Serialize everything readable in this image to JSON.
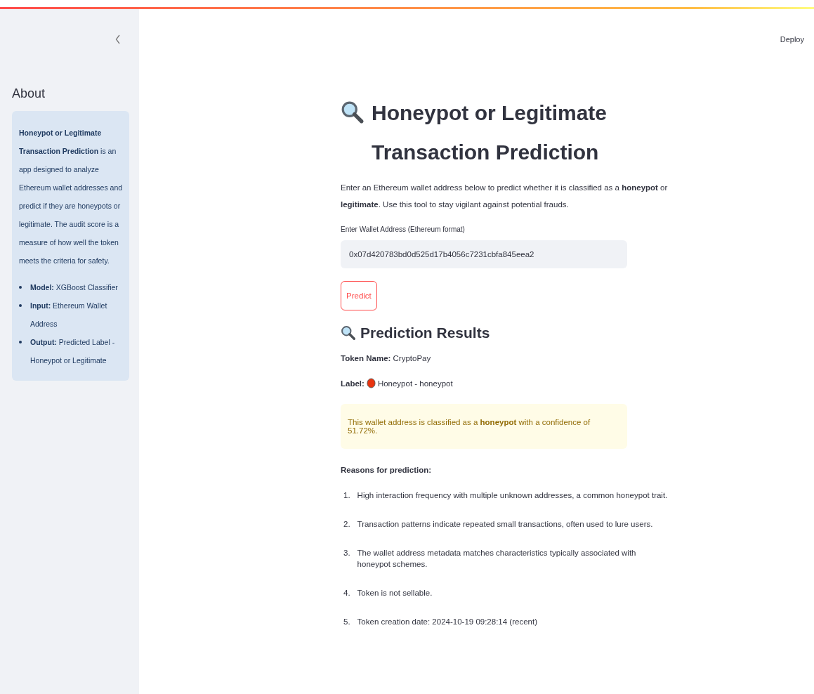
{
  "header": {
    "deploy_label": "Deploy"
  },
  "sidebar": {
    "title": "About",
    "description": "**Honeypot or Legitimate Transaction Prediction** is an app designed to analyze Ethereum wallet addresses and predict if they are honeypots or legitimate. The audit score is a measure of how well the token meets the criteria for safety.",
    "bullets": [
      "**Model:** XGBoost Classifier",
      "**Input:** Ethereum Wallet Address",
      "**Output:** Predicted Label - Honeypot or Legitimate"
    ]
  },
  "main": {
    "title": "Honeypot or Legitimate Transaction Prediction",
    "intro": "Enter an Ethereum wallet address below to predict whether it is classified as a **honeypot** or **legitimate**. Use this tool to stay vigilant against potential frauds.",
    "field": {
      "label": "Enter Wallet Address (Ethereum format)",
      "value": "0x07d420783bd0d525d17b4056c7231cbfa845eea2"
    },
    "predict_button": "Predict",
    "results": {
      "heading": "Prediction Results",
      "token_name": "**Token Name:** CryptoPay",
      "label_key": "Label:",
      "label_value": "Honeypot - honeypot",
      "alert": "This wallet address is classified as a **honeypot** with a confidence of 51.72%.",
      "reasons_heading": "Reasons for prediction:",
      "reasons": [
        {
          "number": "1.",
          "text": "High interaction frequency with multiple unknown addresses, a common honeypot trait."
        },
        {
          "number": "2.",
          "text": "Transaction patterns indicate repeated small transactions, often used to lure users."
        },
        {
          "number": "3.",
          "text": "The wallet address metadata matches characteristics typically associated with honeypot schemes."
        },
        {
          "number": "4.",
          "text": "Token is not sellable."
        },
        {
          "number": "5.",
          "text": "Token creation date: 2024-10-19 09:28:14 (recent)"
        }
      ]
    }
  }
}
